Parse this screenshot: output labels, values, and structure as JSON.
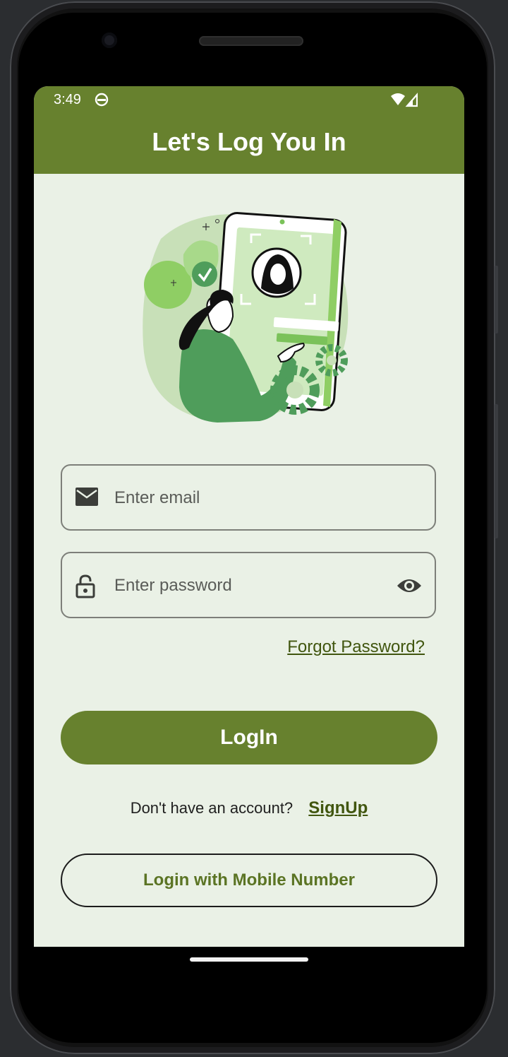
{
  "status_bar": {
    "time": "3:49",
    "icons": [
      "android-face-icon",
      "wifi-icon",
      "signal-icon"
    ]
  },
  "app_bar": {
    "title": "Let's Log You In"
  },
  "illustration": {
    "icon": "login-illustration"
  },
  "email_field": {
    "placeholder": "Enter email",
    "icon": "mail-icon"
  },
  "password_field": {
    "placeholder": "Enter password",
    "icon": "lock-icon",
    "toggle_icon": "eye-icon"
  },
  "forgot_password": "Forgot Password?",
  "login_button": "LogIn",
  "signup_prompt": {
    "text": "Don't have an account?",
    "link": "SignUp"
  },
  "mobile_login_button": "Login with Mobile Number",
  "colors": {
    "primary": "#67812e",
    "background": "#eaf1e6",
    "link": "#41560f"
  }
}
